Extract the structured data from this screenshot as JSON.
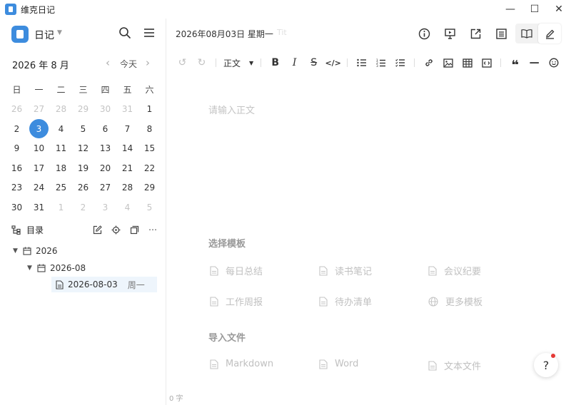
{
  "app": {
    "title": "维克日记"
  },
  "window_controls": {
    "minimize": "—",
    "maximize": "☐",
    "close": "✕"
  },
  "sidebar": {
    "notebook_name": "日记",
    "calendar": {
      "month_label": "2026 年 8 月",
      "today_label": "今天",
      "weekdays": [
        "日",
        "一",
        "二",
        "三",
        "四",
        "五",
        "六"
      ],
      "weeks": [
        [
          "26",
          "27",
          "28",
          "29",
          "30",
          "31",
          "1"
        ],
        [
          "2",
          "3",
          "4",
          "5",
          "6",
          "7",
          "8"
        ],
        [
          "9",
          "10",
          "11",
          "12",
          "13",
          "14",
          "15"
        ],
        [
          "16",
          "17",
          "18",
          "19",
          "20",
          "21",
          "22"
        ],
        [
          "23",
          "24",
          "25",
          "26",
          "27",
          "28",
          "29"
        ],
        [
          "30",
          "31",
          "1",
          "2",
          "3",
          "4",
          "5"
        ]
      ],
      "selected_day": "3"
    },
    "toc": {
      "label": "目录",
      "tree": {
        "year": "2026",
        "month": "2026-08",
        "entry": {
          "date": "2026-08-03",
          "weekday": "周一"
        }
      }
    }
  },
  "main": {
    "date_title": "2026年08月03日 星期一",
    "date_hint": "Tit",
    "toolbar": {
      "paragraph_label": "正文"
    },
    "editor_placeholder": "请输入正文",
    "template_section_title": "选择模板",
    "templates": [
      "每日总结",
      "读书笔记",
      "会议纪要",
      "工作周报",
      "待办清单",
      "更多模板"
    ],
    "import_section_title": "导入文件",
    "imports": [
      "Markdown",
      "Word",
      "文本文件"
    ],
    "word_count": "0 字",
    "help_label": "?"
  },
  "colors": {
    "accent": "#3d8cde",
    "notification_dot": "#e53935"
  }
}
